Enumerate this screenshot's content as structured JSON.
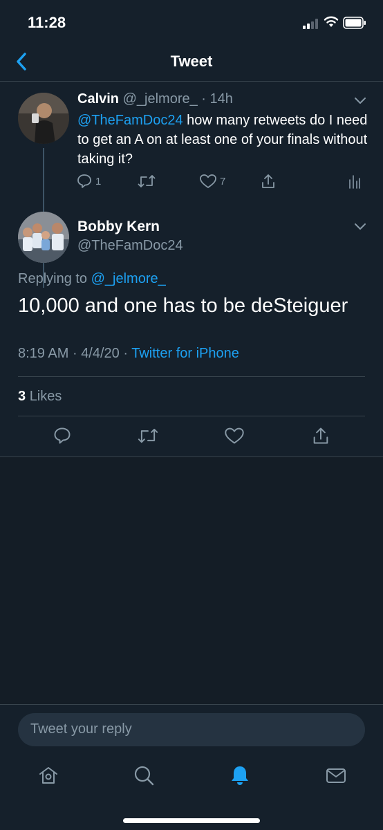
{
  "status_bar": {
    "time": "11:28"
  },
  "nav": {
    "title": "Tweet"
  },
  "parent_tweet": {
    "name": "Calvin",
    "handle": "@_jelmore_",
    "separator": "·",
    "age": "14h",
    "mention": "@TheFamDoc24",
    "text": " how many retweets do I need to get an A on at least one of your finals without taking it?",
    "reply_count": "1",
    "like_count": "7"
  },
  "main_tweet": {
    "name": "Bobby Kern",
    "handle": "@TheFamDoc24",
    "replying_label": "Replying to ",
    "replying_handle": "@_jelmore_",
    "text": "10,000 and one has to be deSteiguer",
    "time": "8:19 AM",
    "date": "4/4/20",
    "separator": "·",
    "source": "Twitter for iPhone",
    "likes_count": "3",
    "likes_label": "Likes"
  },
  "reply_bar": {
    "placeholder": "Tweet your reply"
  },
  "colors": {
    "accent": "#1da1f2",
    "background": "#15202b",
    "muted": "#8899a6",
    "divider": "#38444d"
  },
  "icons": {
    "status": [
      "signal-icon",
      "wifi-icon",
      "battery-icon"
    ],
    "tabs": [
      "home-icon",
      "search-icon",
      "notifications-icon",
      "messages-icon"
    ],
    "tweet_actions": [
      "reply-icon",
      "retweet-icon",
      "like-icon",
      "share-icon",
      "analytics-icon"
    ]
  },
  "active_tab": "notifications"
}
